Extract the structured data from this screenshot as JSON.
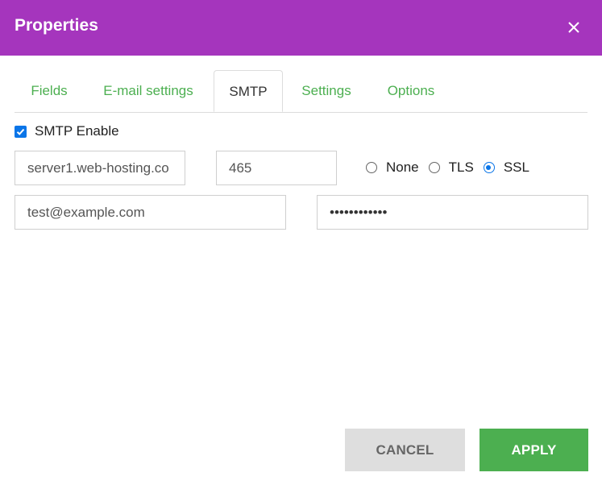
{
  "dialog": {
    "title": "Properties"
  },
  "tabs": [
    {
      "label": "Fields"
    },
    {
      "label": "E-mail settings"
    },
    {
      "label": "SMTP",
      "active": true
    },
    {
      "label": "Settings"
    },
    {
      "label": "Options"
    }
  ],
  "smtp": {
    "enable_label": "SMTP Enable",
    "enabled": true,
    "server_value": "server1.web-hosting.co",
    "port_value": "465",
    "email_value": "test@example.com",
    "password_value": "••••••••••••",
    "encryption": {
      "options": [
        "None",
        "TLS",
        "SSL"
      ],
      "selected": "SSL"
    }
  },
  "buttons": {
    "cancel": "CANCEL",
    "apply": "APPLY"
  },
  "colors": {
    "header": "#a535bd",
    "accent": "#4caf50",
    "checkbox": "#0a75e8"
  },
  "icons": {
    "close": "close-icon",
    "checkbox": "check-icon"
  }
}
